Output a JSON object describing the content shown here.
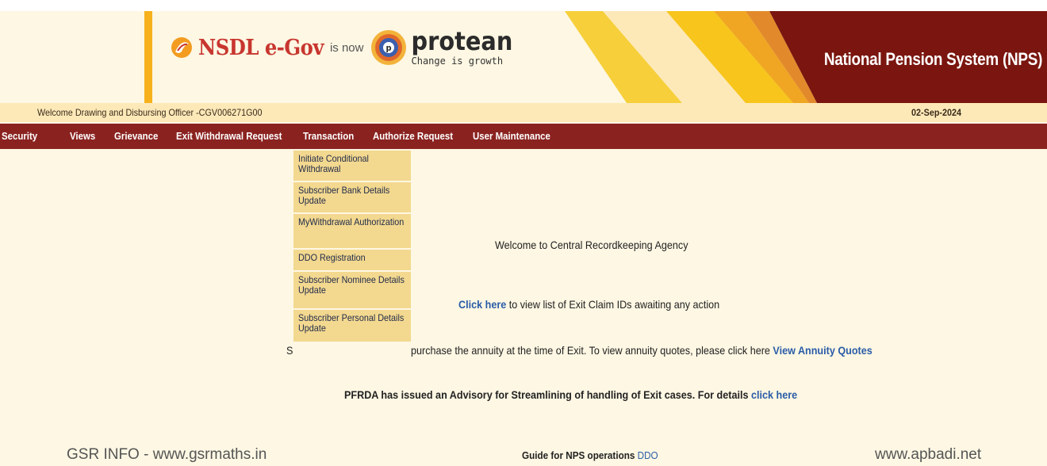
{
  "header": {
    "nsdl_logo_text": "NSDL e-Gov",
    "is_now": "is now",
    "protean_text": "protean",
    "protean_tagline": "Change is growth",
    "system_title": "National Pension System (NPS)"
  },
  "welcome": {
    "text": "Welcome Drawing and Disbursing Officer -CGV006271G00",
    "date": "02-Sep-2024"
  },
  "menu": {
    "items": [
      "Security",
      "Views",
      "Grievance",
      "Exit Withdrawal Request",
      "Transaction",
      "Authorize Request",
      "User Maintenance"
    ]
  },
  "dropdown": {
    "items": [
      "Initiate Conditional Withdrawal",
      "Subscriber Bank Details Update",
      "MyWithdrawal Authorization",
      "DDO Registration",
      "Subscriber Nominee Details Update",
      "Subscriber Personal Details Update"
    ]
  },
  "content": {
    "welcome_cra": "Welcome to Central Recordkeeping Agency",
    "click_here_link": "Click here",
    "click_here_rest": " to view list of Exit Claim IDs awaiting any action",
    "annuity_prefix": "S",
    "annuity_text": "purchase the annuity at the time of Exit. To view annuity quotes, please click here ",
    "annuity_link": "View Annuity Quotes",
    "advisory_text": "PFRDA has issued an Advisory for Streamlining of handling of Exit cases. For details ",
    "advisory_link": "click here",
    "guide_text": "Guide for NPS operations ",
    "guide_link": "DDO"
  },
  "watermarks": {
    "left": "GSR INFO - www.gsrmaths.in",
    "right": "www.apbadi.net"
  },
  "colors": {
    "menu_bar": "#8a2320",
    "background": "#fdf7e3",
    "welcome_bar": "#fde9b8",
    "dropdown": "#f3d88f",
    "link": "#2a5ca8"
  }
}
